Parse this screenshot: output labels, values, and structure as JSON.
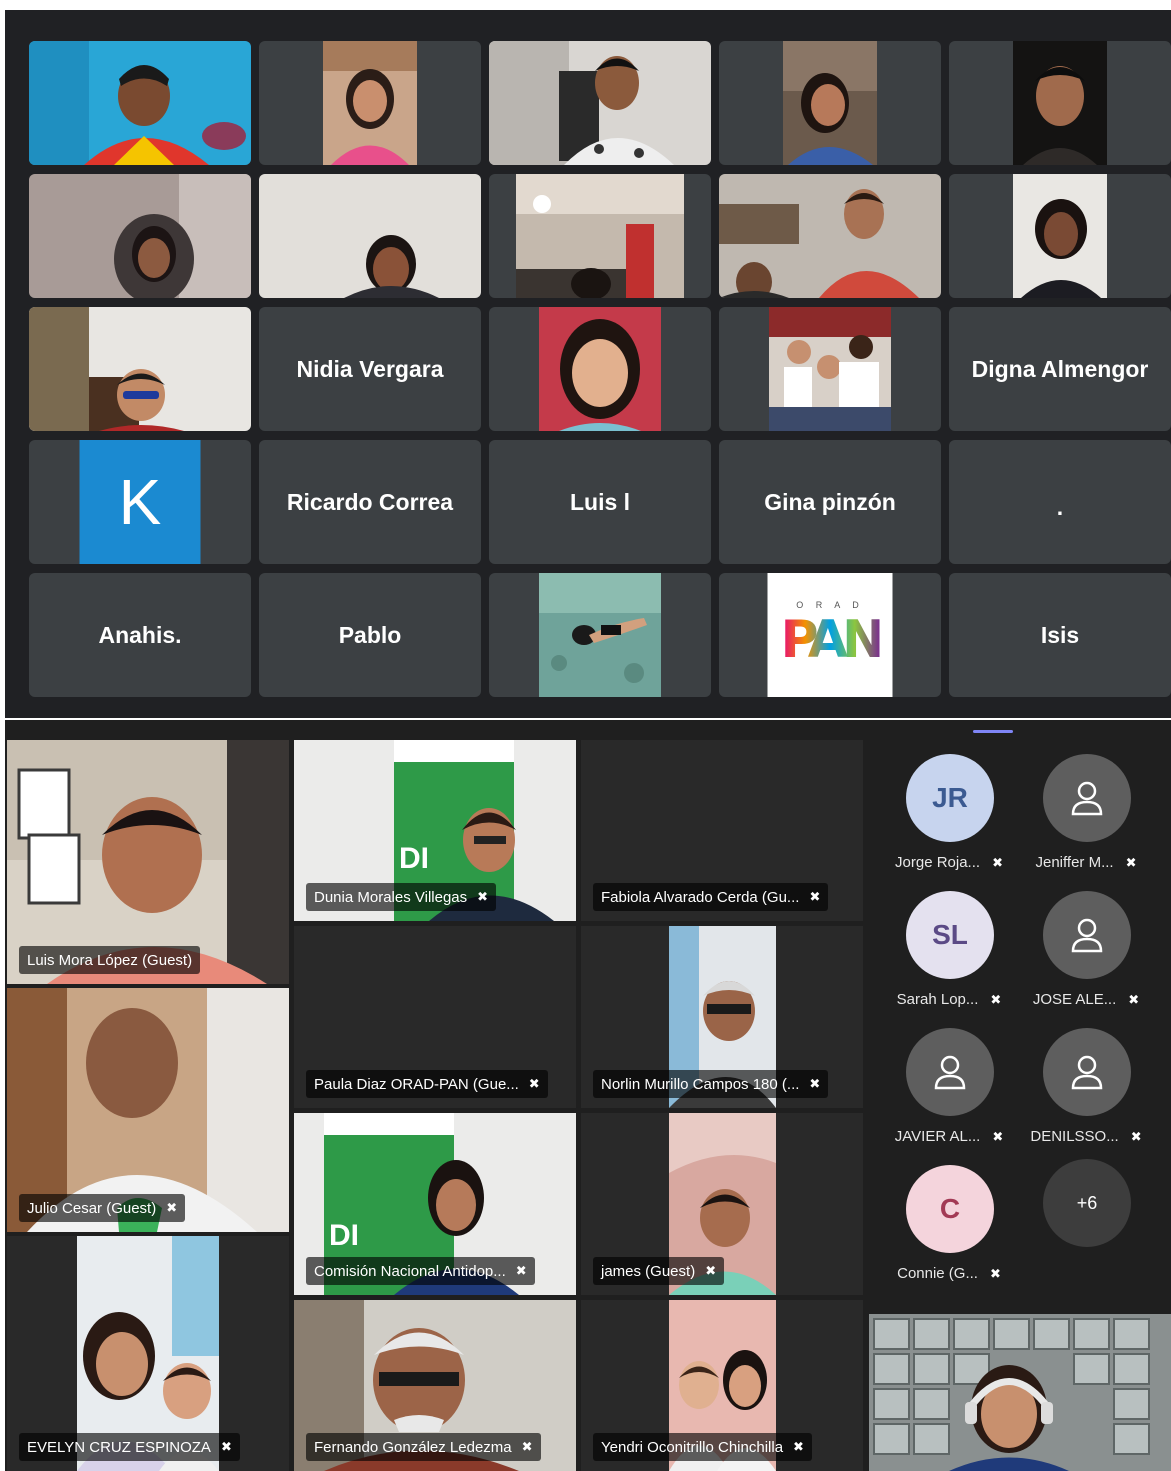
{
  "top_grid": {
    "tiles": [
      {
        "type": "video"
      },
      {
        "type": "video"
      },
      {
        "type": "video"
      },
      {
        "type": "video"
      },
      {
        "type": "video"
      },
      {
        "type": "video"
      },
      {
        "type": "video"
      },
      {
        "type": "video"
      },
      {
        "type": "video"
      },
      {
        "type": "video"
      },
      {
        "type": "video"
      },
      {
        "type": "name",
        "name": "Nidia Vergara"
      },
      {
        "type": "video"
      },
      {
        "type": "video"
      },
      {
        "type": "name",
        "name": "Digna Almengor"
      },
      {
        "type": "avatar",
        "letter": "K"
      },
      {
        "type": "name",
        "name": "Ricardo Correa"
      },
      {
        "type": "name",
        "name": "Luis l"
      },
      {
        "type": "name",
        "name": "Gina pinzón"
      },
      {
        "type": "name",
        "name": "."
      },
      {
        "type": "name",
        "name": "Anahis."
      },
      {
        "type": "name",
        "name": "Pablo"
      },
      {
        "type": "video"
      },
      {
        "type": "logo",
        "logo_top": "O R A D",
        "logo_main": "PAN"
      },
      {
        "type": "name",
        "name": "Isis"
      }
    ]
  },
  "bottom": {
    "videos": [
      {
        "label": "Luis Mora López (Guest)",
        "muted": false
      },
      {
        "label": "Dunia Morales Villegas",
        "muted": true
      },
      {
        "label": "Fabiola Alvarado Cerda (Gu...",
        "muted": true
      },
      {
        "label": "Julio Cesar (Guest)",
        "muted": true
      },
      {
        "label": "Paula Diaz ORAD-PAN (Gue...",
        "muted": true
      },
      {
        "label": "Norlin Murillo Campos 180 (...",
        "muted": true
      },
      {
        "label": "Comisión Nacional Antidop...",
        "muted": true
      },
      {
        "label": "james (Guest)",
        "muted": true
      },
      {
        "label": "EVELYN CRUZ ESPINOZA",
        "muted": true
      },
      {
        "label": "Fernando González Ledezma",
        "muted": true
      },
      {
        "label": "Yendri Oconitrillo Chinchilla",
        "muted": true
      }
    ],
    "people": [
      {
        "initials": "JR",
        "name": "Jorge Roja...",
        "bg": "#c7d4ee",
        "fg": "#3b5a91"
      },
      {
        "initials": "",
        "name": "Jeniffer M...",
        "bg": "#5e5e5e",
        "fg": "#ffffff"
      },
      {
        "initials": "SL",
        "name": "Sarah Lop...",
        "bg": "#e4e1ef",
        "fg": "#5b4a86"
      },
      {
        "initials": "",
        "name": "JOSE ALE...",
        "bg": "#5e5e5e",
        "fg": "#ffffff"
      },
      {
        "initials": "",
        "name": "JAVIER AL...",
        "bg": "#5e5e5e",
        "fg": "#ffffff"
      },
      {
        "initials": "",
        "name": "DENILSSO...",
        "bg": "#5e5e5e",
        "fg": "#ffffff"
      },
      {
        "initials": "C",
        "name": "Connie (G...",
        "bg": "#f4d4dc",
        "fg": "#a23a55"
      }
    ],
    "more_count": "+6"
  }
}
